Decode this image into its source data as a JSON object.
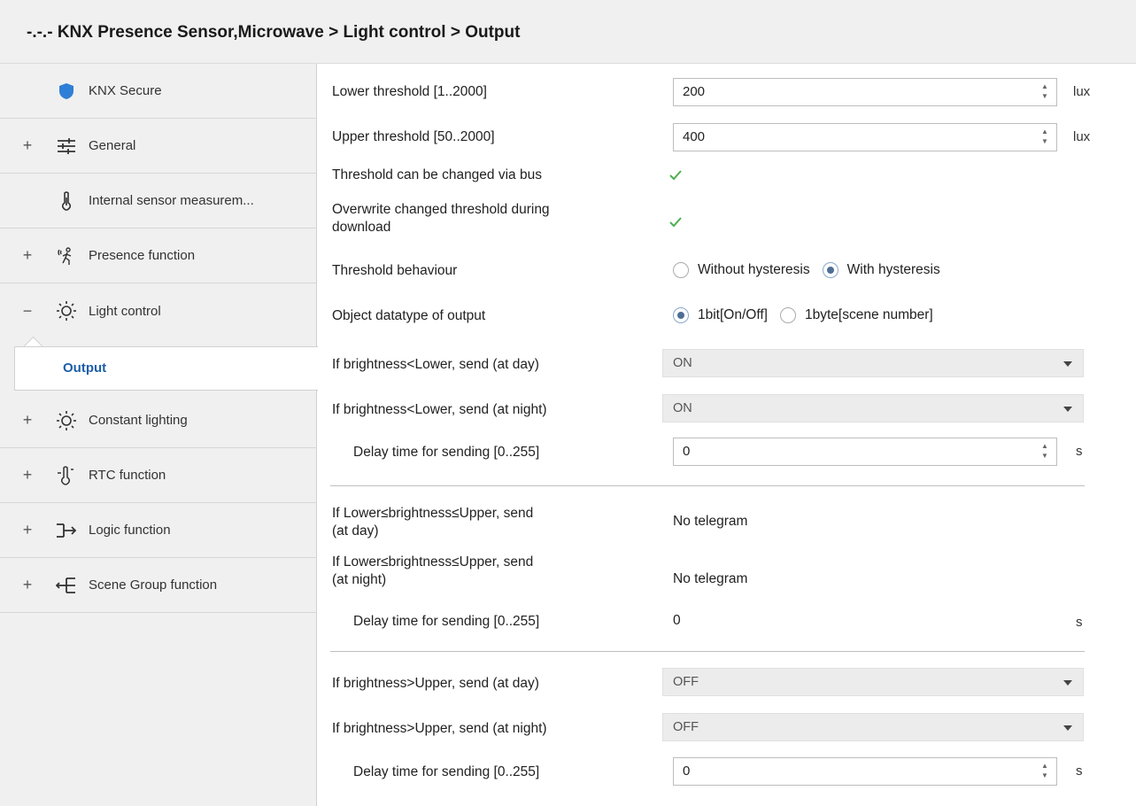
{
  "breadcrumb": "-.-.- KNX Presence Sensor,Microwave > Light control > Output",
  "sidebar": {
    "items": [
      {
        "label": "KNX Secure",
        "expander": "",
        "icon": "shield-icon"
      },
      {
        "label": "General",
        "expander": "+",
        "icon": "sliders-icon"
      },
      {
        "label": "Internal sensor measurem...",
        "expander": "",
        "icon": "thermometer-icon"
      },
      {
        "label": "Presence function",
        "expander": "+",
        "icon": "person-motion-icon"
      },
      {
        "label": "Light control",
        "expander": "−",
        "icon": "sun-icon"
      },
      {
        "label": "Output",
        "expander": "",
        "icon": ""
      },
      {
        "label": "Constant lighting",
        "expander": "+",
        "icon": "sun-icon"
      },
      {
        "label": "RTC function",
        "expander": "+",
        "icon": "rtc-icon"
      },
      {
        "label": "Logic function",
        "expander": "+",
        "icon": "logic-icon"
      },
      {
        "label": "Scene Group function",
        "expander": "+",
        "icon": "scene-icon"
      }
    ]
  },
  "params": {
    "lower_threshold": {
      "label": "Lower threshold [1..2000]",
      "value": "200",
      "unit": "lux"
    },
    "upper_threshold": {
      "label": "Upper threshold [50..2000]",
      "value": "400",
      "unit": "lux"
    },
    "threshold_bus": {
      "label": "Threshold can be changed via bus",
      "checked": true
    },
    "overwrite": {
      "label_line1": "Overwrite changed threshold during",
      "label_line2": "download",
      "checked": true
    },
    "behaviour": {
      "label": "Threshold behaviour",
      "opt1": "Without hysteresis",
      "opt2": "With hysteresis",
      "selected": "With hysteresis"
    },
    "datatype": {
      "label": "Object datatype of output",
      "opt1": "1bit[On/Off]",
      "opt2": "1byte[scene number]",
      "selected": "1bit[On/Off]"
    },
    "lower_day": {
      "label": "If brightness<Lower, send (at day)",
      "value": "ON"
    },
    "lower_night": {
      "label": "If brightness<Lower, send (at night)",
      "value": "ON"
    },
    "lower_delay": {
      "label": "Delay time for sending [0..255]",
      "value": "0",
      "unit": "s"
    },
    "mid_day": {
      "label_line1": "If Lower≤brightness≤Upper, send",
      "label_line2": "(at day)",
      "value": "No telegram"
    },
    "mid_night": {
      "label_line1": "If Lower≤brightness≤Upper, send",
      "label_line2": "(at night)",
      "value": "No telegram"
    },
    "mid_delay": {
      "label": "Delay time for sending [0..255]",
      "value": "0",
      "unit": "s"
    },
    "upper_day": {
      "label": "If brightness>Upper, send (at day)",
      "value": "OFF"
    },
    "upper_night": {
      "label": "If brightness>Upper, send (at night)",
      "value": "OFF"
    },
    "upper_delay": {
      "label": "Delay time for sending [0..255]",
      "value": "0",
      "unit": "s"
    }
  },
  "colors": {
    "accent": "#1d5ea8",
    "check": "#4caf50",
    "shield": "#2f7fd6"
  }
}
